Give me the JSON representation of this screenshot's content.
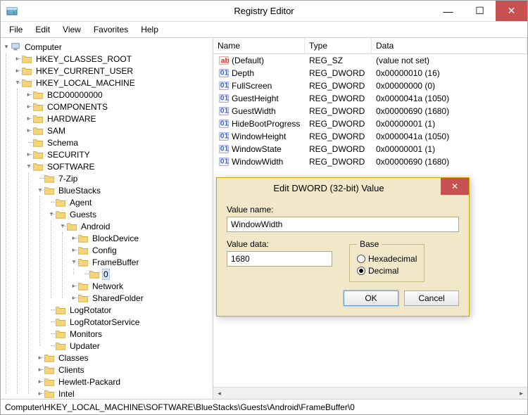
{
  "window": {
    "title": "Registry Editor"
  },
  "menubar": {
    "items": [
      "File",
      "Edit",
      "View",
      "Favorites",
      "Help"
    ]
  },
  "tree": {
    "root": "Computer",
    "hives": {
      "hkcr": "HKEY_CLASSES_ROOT",
      "hkcu": "HKEY_CURRENT_USER",
      "hklm": "HKEY_LOCAL_MACHINE"
    },
    "hklm_children": [
      "BCD00000000",
      "COMPONENTS",
      "HARDWARE",
      "SAM",
      "Schema",
      "SECURITY"
    ],
    "software": "SOFTWARE",
    "software_children_pre": [
      "7-Zip"
    ],
    "bluestacks": "BlueStacks",
    "bluestacks_children": {
      "agent": "Agent",
      "guests": "Guests",
      "android": "Android",
      "android_children_pre": [
        "BlockDevice",
        "Config"
      ],
      "framebuffer": "FrameBuffer",
      "fb_child": "0",
      "android_children_post": [
        "Network",
        "SharedFolder"
      ],
      "post_guests": [
        "LogRotator",
        "LogRotatorService",
        "Monitors",
        "Updater"
      ]
    },
    "software_children_post": [
      "Classes",
      "Clients",
      "Hewlett-Packard",
      "Intel"
    ]
  },
  "list": {
    "headers": {
      "name": "Name",
      "type": "Type",
      "data": "Data"
    },
    "rows": [
      {
        "icon": "sz",
        "name": "(Default)",
        "type": "REG_SZ",
        "data": "(value not set)"
      },
      {
        "icon": "dw",
        "name": "Depth",
        "type": "REG_DWORD",
        "data": "0x00000010 (16)"
      },
      {
        "icon": "dw",
        "name": "FullScreen",
        "type": "REG_DWORD",
        "data": "0x00000000 (0)"
      },
      {
        "icon": "dw",
        "name": "GuestHeight",
        "type": "REG_DWORD",
        "data": "0x0000041a (1050)"
      },
      {
        "icon": "dw",
        "name": "GuestWidth",
        "type": "REG_DWORD",
        "data": "0x00000690 (1680)"
      },
      {
        "icon": "dw",
        "name": "HideBootProgress",
        "type": "REG_DWORD",
        "data": "0x00000001 (1)"
      },
      {
        "icon": "dw",
        "name": "WindowHeight",
        "type": "REG_DWORD",
        "data": "0x0000041a (1050)"
      },
      {
        "icon": "dw",
        "name": "WindowState",
        "type": "REG_DWORD",
        "data": "0x00000001 (1)"
      },
      {
        "icon": "dw",
        "name": "WindowWidth",
        "type": "REG_DWORD",
        "data": "0x00000690 (1680)"
      }
    ]
  },
  "dialog": {
    "title": "Edit DWORD (32-bit) Value",
    "value_name_label": "Value name:",
    "value_name": "WindowWidth",
    "value_data_label": "Value data:",
    "value_data": "1680",
    "base_label": "Base",
    "hex_label": "Hexadecimal",
    "dec_label": "Decimal",
    "selected_base": "decimal",
    "ok": "OK",
    "cancel": "Cancel"
  },
  "statusbar": {
    "path": "Computer\\HKEY_LOCAL_MACHINE\\SOFTWARE\\BlueStacks\\Guests\\Android\\FrameBuffer\\0"
  }
}
